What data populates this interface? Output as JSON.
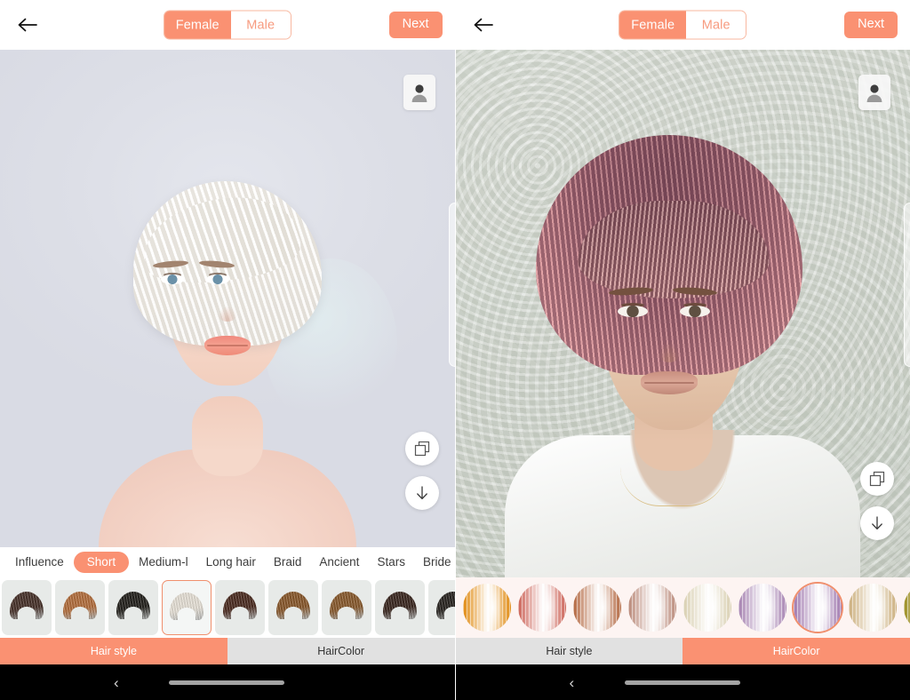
{
  "app": {
    "accent": "#fa9172",
    "accent_light": "#f8b79f",
    "thumb_bg": "#e7eae8",
    "color_strip_bg": "#fdf4f2"
  },
  "header": {
    "back_icon": "arrow-left-icon",
    "gender_options": [
      "Female",
      "Male"
    ],
    "gender_selected": "Female",
    "next_label": "Next"
  },
  "stage": {
    "avatar_icon": "person-icon",
    "compare_icon": "layers-compare-icon",
    "download_icon": "arrow-down-icon"
  },
  "categories": {
    "items": [
      "Influence",
      "Short",
      "Medium-l",
      "Long hair",
      "Braid",
      "Ancient",
      "Stars",
      "Bride"
    ],
    "selected": "Short"
  },
  "hairstyles": {
    "selected_index": 3,
    "items": [
      {
        "name": "style-1",
        "color": "#4a342c"
      },
      {
        "name": "style-2",
        "color": "#b4703f"
      },
      {
        "name": "style-3",
        "color": "#26241f"
      },
      {
        "name": "style-4",
        "color": "#e8e2d8"
      },
      {
        "name": "style-5",
        "color": "#4e2f24"
      },
      {
        "name": "style-6",
        "color": "#8a5a2e"
      },
      {
        "name": "style-7",
        "color": "#8a5c30"
      },
      {
        "name": "style-8",
        "color": "#3d2a22"
      },
      {
        "name": "style-9",
        "color": "#2b2723"
      }
    ]
  },
  "haircolors": {
    "selected_index": 6,
    "items": [
      {
        "name": "color-golden-orange",
        "color": "#e08a11"
      },
      {
        "name": "color-coral-red",
        "color": "#cc6357"
      },
      {
        "name": "color-copper",
        "color": "#b2663f"
      },
      {
        "name": "color-rose-brown",
        "color": "#b98878"
      },
      {
        "name": "color-platinum-beige",
        "color": "#d9cfb1"
      },
      {
        "name": "color-lilac",
        "color": "#a581b0"
      },
      {
        "name": "color-violet",
        "color": "#9f78ae"
      },
      {
        "name": "color-blonde",
        "color": "#cbae7c"
      },
      {
        "name": "color-olive",
        "color": "#9a8c1f"
      }
    ]
  },
  "mode_tabs": {
    "items": [
      "Hair style",
      "HairColor"
    ],
    "left_selected": "Hair style",
    "right_selected": "HairColor"
  },
  "navbar": {
    "back_glyph": "‹",
    "home_indicator": "home-pill"
  }
}
